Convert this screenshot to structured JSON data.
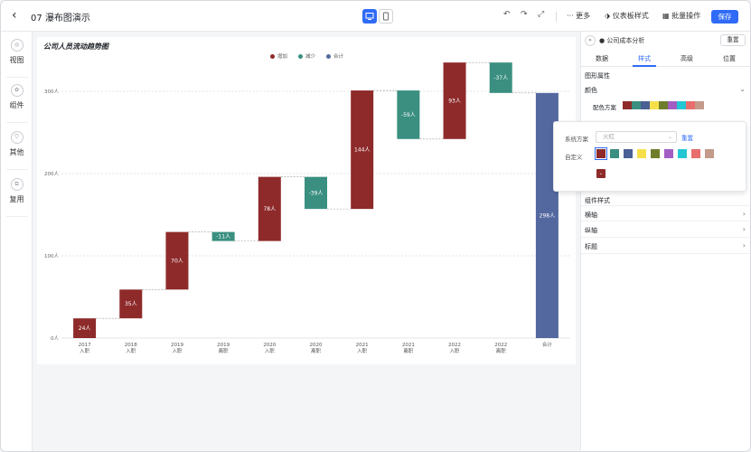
{
  "header": {
    "title": "07 瀑布图演示",
    "more": "··· 更多",
    "dashboard_style": "仪表板样式",
    "batch": "批量操作",
    "save": "保存"
  },
  "rail": {
    "items": [
      {
        "label": "视图",
        "icon": "view-icon"
      },
      {
        "label": "组件",
        "icon": "component-icon"
      },
      {
        "label": "其他",
        "icon": "other-icon"
      },
      {
        "label": "复用",
        "icon": "reuse-icon"
      }
    ]
  },
  "chart_data": {
    "type": "bar",
    "title": "公司人员流动趋势图",
    "legend": [
      "增加",
      "减少",
      "合计"
    ],
    "legend_placement": "top-center",
    "colors": {
      "increase": "#8e2a2a",
      "decrease": "#3a8f80",
      "total": "#5468a0"
    },
    "categories": [
      [
        "2017",
        "入职"
      ],
      [
        "2018",
        "入职"
      ],
      [
        "2019",
        "入职"
      ],
      [
        "2019",
        "离职"
      ],
      [
        "2020",
        "入职"
      ],
      [
        "2020",
        "离职"
      ],
      [
        "2021",
        "入职"
      ],
      [
        "2021",
        "离职"
      ],
      [
        "2022",
        "入职"
      ],
      [
        "2022",
        "离职"
      ],
      [
        "合计",
        ""
      ]
    ],
    "values": [
      24,
      35,
      70,
      -11,
      78,
      -39,
      144,
      -59,
      93,
      -37,
      298
    ],
    "value_labels": [
      "24人",
      "35人",
      "70人",
      "-11人",
      "78人",
      "-39人",
      "144人",
      "-59人",
      "93人",
      "-37人",
      "298人"
    ],
    "kinds": [
      "increase",
      "increase",
      "increase",
      "decrease",
      "increase",
      "decrease",
      "increase",
      "decrease",
      "increase",
      "decrease",
      "total"
    ],
    "ylim": [
      0,
      300
    ],
    "yticks": [
      0,
      100,
      200,
      300
    ],
    "ytick_labels": [
      "0人",
      "100人",
      "200人",
      "300人"
    ],
    "grid": true
  },
  "panel": {
    "title": "公司成本分析",
    "reset": "重置",
    "tabs": [
      "数据",
      "样式",
      "高级",
      "位置"
    ],
    "active_tab": "样式",
    "section_graph": "图形属性",
    "color_row": "颜色",
    "scheme_label": "配色方案",
    "section_component": "组件样式",
    "rows": [
      "横轴",
      "纵轴",
      "标题"
    ]
  },
  "palette": [
    "#8e2a2a",
    "#3a8f80",
    "#4a5f94",
    "#f5e04a",
    "#6e7e2a",
    "#a25ec2",
    "#23c7d3",
    "#e86d6d",
    "#c49a8a"
  ],
  "popup": {
    "system_label": "系统方案",
    "system_value": "火红",
    "reset": "重置",
    "custom_label": "自定义"
  }
}
